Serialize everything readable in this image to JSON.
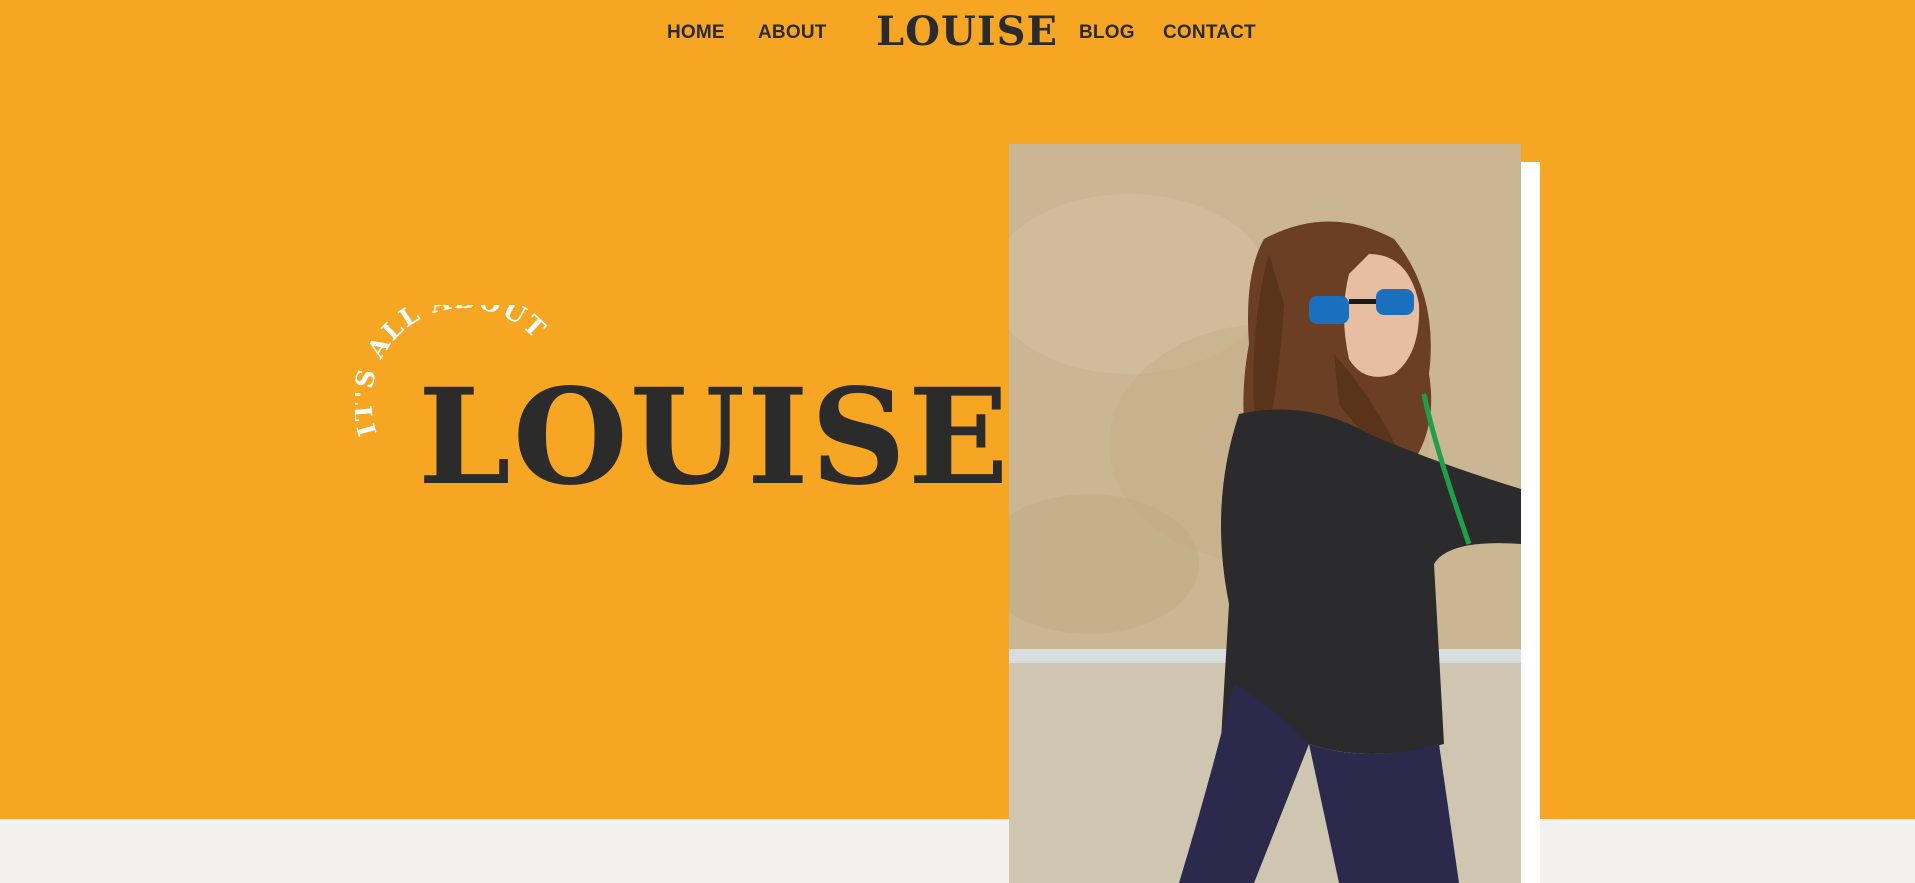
{
  "nav": {
    "home_label": "HOME",
    "about_label": "ABOUT",
    "logo": "LOUISE",
    "blog_label": "BLOG",
    "contact_label": "CONTACT"
  },
  "hero": {
    "tagline": "IT'S ALL ABOUT",
    "title": "LOUISE"
  },
  "colors": {
    "accent": "#f6a623",
    "text": "#2b2b2b",
    "footer_bg": "#f2f1ef",
    "photo_frame": "#ffffff"
  }
}
